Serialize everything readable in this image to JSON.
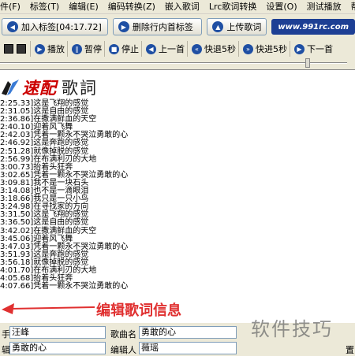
{
  "menu": [
    "件(F)",
    "标签(T)",
    "编辑(E)",
    "编码转换(Z)",
    "嵌入歌词",
    "Lrc歌词转换",
    "设置(O)",
    "测试播放",
    "帮助"
  ],
  "toolbar1": {
    "add_tag": "加入标签[04:17.72]",
    "delete_tag": "删除行内首标签",
    "upload": "上传歌词",
    "site": "www.991rc.com"
  },
  "toolbar2": {
    "play": "播放",
    "pause": "暂停",
    "stop": "停止",
    "prev": "上一首",
    "rewind": "快退5秒",
    "forward": "快进5秒",
    "next": "下一首"
  },
  "slider": {
    "position": 0.88
  },
  "logo": {
    "accent": "速配",
    "main": "歌詞"
  },
  "lyrics": [
    "2:25.33]这是飞翔的感觉",
    "2:31.05]这是自由的感觉",
    "2:36.86]在撒满鲜血的天空",
    "2:40.10]迎着风飞舞",
    "2:42.03]凭着一颗永不哭泣勇敢的心",
    "2:46.92]这是奔跑的感觉",
    "2:51.28]就像掉脱的感觉",
    "2:56.99]在布满利刃的大地",
    "3:00.73]抬着头狂奔",
    "3:02.65]凭着一颗永不哭泣勇敢的心",
    "3:09.81]我不是一块石头",
    "3:14.08]也不是一滴眼泪",
    "3:18.66]我只是一只小鸟",
    "3:24.98]在寻找家的方向",
    "3:31.50]这是飞翔的感觉",
    "3:36.50]这是自由的感觉",
    "3:42.02]在撒满鲜血的天空",
    "3:45.06]迎着风飞舞",
    "3:47.03]凭着一颗永不哭泣勇敢的心",
    "3:51.93]这是奔跑的感觉",
    "3:56.18]就像掉脱的感觉",
    "4:01.70]在布满利刃的大地",
    "4:05.68]抬着头狂奔",
    "4:07.66]凭着一颗永不哭泣勇敢的心"
  ],
  "annotation": "编辑歌词信息",
  "form": {
    "singer_label": "手",
    "singer_value": "汪峰",
    "song_label": "歌曲名",
    "song_value": "勇敢的心",
    "album_label": "辑",
    "album_value": "勇敢的心",
    "editor_label": "编辑人",
    "editor_value": "薇瑶",
    "extra_label": "置"
  },
  "watermark": "软件技巧",
  "colors": {
    "accent": "#e03030",
    "site_badge": "#1d3f94",
    "circle_icon": "#1f4fa3"
  }
}
